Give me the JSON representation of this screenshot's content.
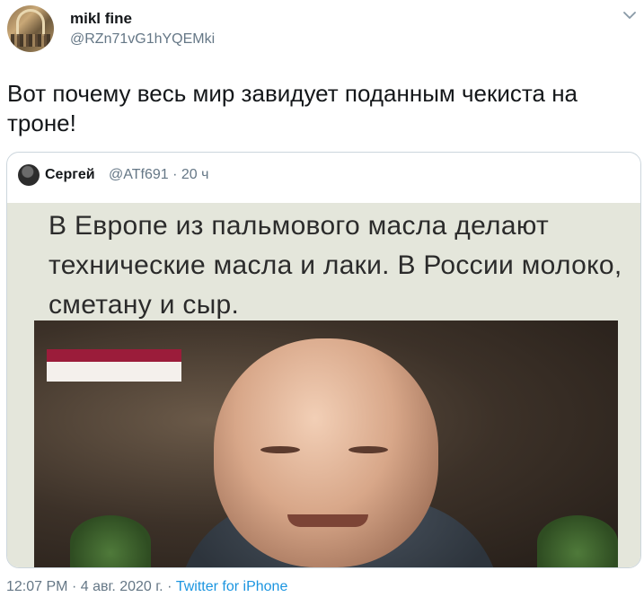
{
  "tweet": {
    "author": {
      "name": "mikl fine",
      "handle": "@RZn71vG1hYQEMki"
    },
    "text": "Вот почему весь мир завидует поданным чекиста на троне!",
    "menu_icon": "chevron-down-icon"
  },
  "quoted": {
    "author": {
      "name": "Сергей",
      "handle": "@ATf691"
    },
    "separator": "·",
    "time": "20 ч",
    "image_text": "В Европе из пальмового масла делают технические масла и лаки.  В России молоко, сметану и сыр."
  },
  "footer": {
    "time": "12:07 PM",
    "date": "4 авг. 2020 г.",
    "sep": "·",
    "source": "Twitter for iPhone"
  },
  "colors": {
    "accent": "#1b95e0",
    "secondary_text": "#657786",
    "border": "#ccd6dd"
  }
}
